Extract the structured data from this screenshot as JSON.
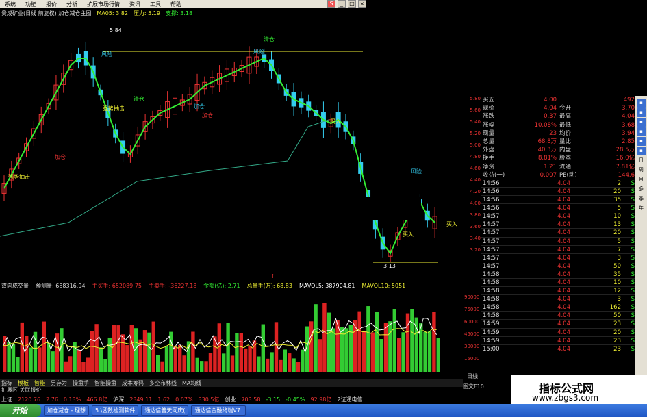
{
  "menu": [
    "系统",
    "功能",
    "报价",
    "分析",
    "扩展市场行情",
    "资讯",
    "工具",
    "帮助"
  ],
  "info": {
    "stock": "贵成矿业(日线 前复权) 加仓减仓主图",
    "ma": "MA05: 3.82",
    "pressure": "压力: 5.19",
    "support": "支撑: 3.18"
  },
  "chart_labels": {
    "high": "5.84",
    "low": "3.13",
    "qingcang1": "清仓",
    "qingcang2": "清仓",
    "fengxian1": "风险",
    "fengxian2": "风险",
    "fengxian3": "风险",
    "qiangshi1": "强势抽击",
    "qiangshi2": "强势抽击",
    "jiacang1": "加仓",
    "jiacang2": "加仓",
    "jiacang3": "加仓",
    "mairu1": "买入",
    "mairu2": "买入",
    "mairu3": "买入",
    "arrow": "↑"
  },
  "price_axis": [
    "5.80",
    "5.60",
    "5.40",
    "5.20",
    "5.00",
    "4.80",
    "4.60",
    "4.40",
    "4.20",
    "4.00",
    "3.80",
    "3.60",
    "3.40",
    "3.20"
  ],
  "quote": [
    {
      "a": "买五",
      "b": "4.00",
      "c": "",
      "d": "492"
    },
    {
      "a": "现价",
      "b": "4.04",
      "c": "今开",
      "d": "3.70"
    },
    {
      "a": "涨跌",
      "b": "0.37",
      "c": "最高",
      "d": "4.04"
    },
    {
      "a": "涨幅",
      "b": "10.08%",
      "c": "最低",
      "d": "3.68"
    },
    {
      "a": "现量",
      "b": "23",
      "c": "均价",
      "d": "3.94"
    },
    {
      "a": "总量",
      "b": "68.8万",
      "c": "量比",
      "d": "2.85"
    },
    {
      "a": "外盘",
      "b": "40.3万",
      "c": "内盘",
      "d": "28.5万"
    },
    {
      "a": "换手",
      "b": "8.81%",
      "c": "股本",
      "d": "16.0亿"
    },
    {
      "a": "净资",
      "b": "1.21",
      "c": "流通",
      "d": "7.81亿"
    },
    {
      "a": "收益(一)",
      "b": "0.007",
      "c": "PE(动)",
      "d": "144.6"
    }
  ],
  "ticks": [
    {
      "t": "14:56",
      "p": "4.04",
      "v": "2",
      "s": "S"
    },
    {
      "t": "14:56",
      "p": "4.04",
      "v": "20",
      "s": "S"
    },
    {
      "t": "14:56",
      "p": "4.04",
      "v": "35",
      "s": "S"
    },
    {
      "t": "14:56",
      "p": "4.04",
      "v": "5",
      "s": "S"
    },
    {
      "t": "14:57",
      "p": "4.04",
      "v": "10",
      "s": "S"
    },
    {
      "t": "14:57",
      "p": "4.04",
      "v": "13",
      "s": "S"
    },
    {
      "t": "14:57",
      "p": "4.04",
      "v": "20",
      "s": "S"
    },
    {
      "t": "14:57",
      "p": "4.04",
      "v": "5",
      "s": "S"
    },
    {
      "t": "14:57",
      "p": "4.04",
      "v": "7",
      "s": "S"
    },
    {
      "t": "14:57",
      "p": "4.04",
      "v": "3",
      "s": "S"
    },
    {
      "t": "14:57",
      "p": "4.04",
      "v": "50",
      "s": "S"
    },
    {
      "t": "14:58",
      "p": "4.04",
      "v": "35",
      "s": "S"
    },
    {
      "t": "14:58",
      "p": "4.04",
      "v": "10",
      "s": "S"
    },
    {
      "t": "14:58",
      "p": "4.04",
      "v": "12",
      "s": "S"
    },
    {
      "t": "14:58",
      "p": "4.04",
      "v": "3",
      "s": "S"
    },
    {
      "t": "14:58",
      "p": "4.04",
      "v": "162",
      "s": "S"
    },
    {
      "t": "14:58",
      "p": "4.04",
      "v": "50",
      "s": "S"
    },
    {
      "t": "14:59",
      "p": "4.04",
      "v": "23",
      "s": "S"
    },
    {
      "t": "14:59",
      "p": "4.04",
      "v": "20",
      "s": "S"
    },
    {
      "t": "14:59",
      "p": "4.04",
      "v": "23",
      "s": "S"
    },
    {
      "t": "15:00",
      "p": "4.04",
      "v": "23",
      "s": "S"
    }
  ],
  "sidebar": [
    "日",
    "周",
    "月",
    "多",
    "季",
    "年"
  ],
  "sidebar_icons": [
    "search-icon",
    "zoom-in-icon",
    "zoom-out-icon",
    "indicator-icon",
    "rsi-icon",
    "draw-icon"
  ],
  "volinfo": {
    "title": "双向成交量",
    "forecast": "预测量: 688316.94",
    "main_buy": "主买手: 652089.75",
    "main_sell": "主卖手: -36227.18",
    "amount": "金额(亿): 2.71",
    "total": "总量手(万): 68.83",
    "mavol5": "MAVOL5: 387904.81",
    "mavol10": "MAVOL10: 5051"
  },
  "vol_axis": [
    "90000",
    "75000",
    "60000",
    "45000",
    "30000",
    "15000"
  ],
  "tabs": [
    "指标",
    "模板",
    "智能",
    "另存为",
    "操盘手",
    "智能操盘",
    "成本筹码",
    "多空布林线",
    "MA均线"
  ],
  "subtab": "扩展区  关联报价",
  "right_bottom": [
    "日线",
    "图文F10"
  ],
  "ticker": [
    "上证",
    "2120.76",
    "2.76",
    "0.13%",
    "466.8亿",
    "沪深",
    "2349.11",
    "1.62",
    "0.07%",
    "330.5亿",
    "创业",
    "703.58",
    "-3.15",
    "-0.45%",
    "92.98亿",
    "2证通电信"
  ],
  "taskbar": {
    "start": "开始",
    "items": [
      "加仓减仓 - 理想",
      "5 \\函数检测软件",
      "通达信普天同庆(",
      "通达信金融终端V7."
    ]
  },
  "watermark": {
    "title": "指标公式网",
    "url": "www.zbgs3.com"
  },
  "colors": {
    "up": "#e33",
    "down": "#3ce",
    "ma": "#ee3"
  }
}
